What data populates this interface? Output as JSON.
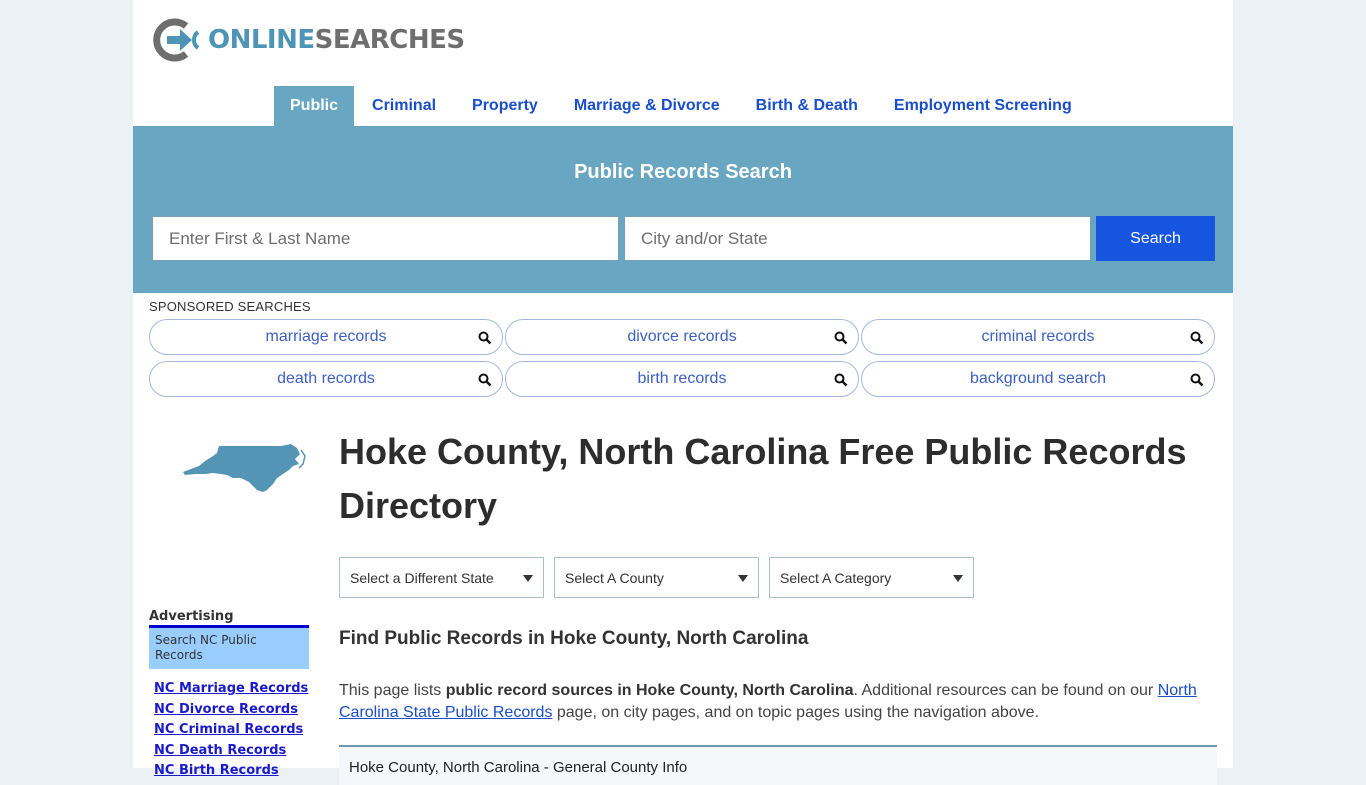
{
  "brand": {
    "online": "ONLINE",
    "searches": "SEARCHES",
    "primary_color": "#4e95b5",
    "secondary_color": "#6e6e6e"
  },
  "nav": {
    "items": [
      {
        "label": "Public",
        "active": true
      },
      {
        "label": "Criminal"
      },
      {
        "label": "Property"
      },
      {
        "label": "Marriage & Divorce"
      },
      {
        "label": "Birth & Death"
      },
      {
        "label": "Employment Screening"
      }
    ]
  },
  "search": {
    "title": "Public Records Search",
    "name_placeholder": "Enter First & Last Name",
    "name_value": "",
    "location_placeholder": "City and/or State",
    "location_value": "",
    "button_label": "Search",
    "band_color": "#69a6c1",
    "button_color": "#1555e0"
  },
  "sponsored": {
    "label": "SPONSORED SEARCHES",
    "items": [
      {
        "label": "marriage records",
        "icon": "search-icon"
      },
      {
        "label": "divorce records",
        "icon": "search-icon"
      },
      {
        "label": "criminal records",
        "icon": "search-icon"
      },
      {
        "label": "death records",
        "icon": "search-icon"
      },
      {
        "label": "birth records",
        "icon": "search-icon"
      },
      {
        "label": "background search",
        "icon": "search-icon"
      }
    ]
  },
  "main": {
    "title": "Hoke County, North Carolina Free Public Records Directory",
    "selects": [
      {
        "selected": "Select a Different State"
      },
      {
        "selected": "Select A County"
      },
      {
        "selected": "Select A Category"
      }
    ],
    "section_heading": "Find Public Records in Hoke County, North Carolina",
    "intro": {
      "prefix": "This page lists ",
      "bold": "public record sources in Hoke County, North Carolina",
      "middle": ". Additional resources can be found on our ",
      "link": "North Carolina State Public Records",
      "suffix": " page, on city pages, and on topic pages using the navigation above."
    },
    "info_box_title": "Hoke County, North Carolina - General County Info"
  },
  "sidebar": {
    "state_icon": "north-carolina-map",
    "advertising_label": "Advertising",
    "ad_box_text": "Search NC Public Records",
    "links": [
      "NC Marriage Records",
      "NC Divorce Records",
      "NC Criminal Records",
      "NC Death Records",
      "NC Birth Records"
    ]
  }
}
